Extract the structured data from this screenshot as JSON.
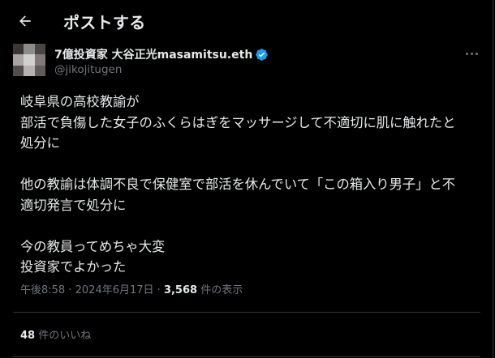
{
  "header": {
    "title": "ポストする"
  },
  "author": {
    "display_name": "7億投資家 大谷正光masamitsu.eth",
    "handle": "@jikojitugen",
    "verified": true
  },
  "tweet": {
    "lines": [
      "岐阜県の高校教諭が",
      "部活で負傷した女子のふくらはぎをマッサージして不適切に肌に触れたと",
      "処分に",
      "",
      "他の教諭は体調不良で保健室で部活を休んでいて「この箱入り男子」と不",
      "適切発言で処分に",
      "",
      "今の教員ってめちゃ大変",
      "投資家でよかった"
    ]
  },
  "meta": {
    "time": "午後8:58",
    "sep1": "·",
    "date": "2024年6月17日",
    "sep2": "·",
    "views_count": "3,568",
    "views_label": "件の表示"
  },
  "engagement": {
    "likes_count": "48",
    "likes_label": "件のいいね"
  },
  "colors": {
    "background": "#000000",
    "text_primary": "#e7e9ea",
    "text_secondary": "#71767b",
    "divider": "#2f3336",
    "verified_badge": "#1d9bf0"
  }
}
